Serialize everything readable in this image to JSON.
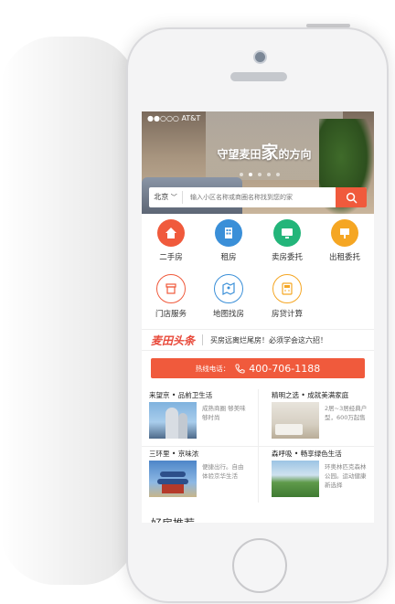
{
  "status_bar": {
    "carrier": "●●○○○ AT&T"
  },
  "hero": {
    "slogan_prefix": "守望麦田",
    "slogan_big": "家",
    "slogan_suffix": "的方向"
  },
  "search": {
    "city": "北京",
    "placeholder": "输入小区名称或商圈名称找到您的家"
  },
  "grid": {
    "items": [
      {
        "label": "二手房",
        "color": "#f05a3c",
        "icon": "house-icon"
      },
      {
        "label": "租房",
        "color": "#3a8fd8",
        "icon": "building-icon"
      },
      {
        "label": "卖房委托",
        "color": "#23b57a",
        "icon": "monitor-icon"
      },
      {
        "label": "出租委托",
        "color": "#f5a623",
        "icon": "sign-icon"
      },
      {
        "label": "门店服务",
        "color": "#f05a3c",
        "icon": "store-icon"
      },
      {
        "label": "地图找房",
        "color": "#3a8fd8",
        "icon": "map-icon"
      },
      {
        "label": "房贷计算",
        "color": "#f5a623",
        "icon": "calculator-icon"
      }
    ]
  },
  "news": {
    "brand": "麦田头条",
    "headline": "买房远离烂尾房！必须学会这六招！"
  },
  "hotline": {
    "label": "热线电话：",
    "number": "400-706-1188"
  },
  "cards": [
    {
      "title": "来望京 • 品前卫生活",
      "desc": "成熟商圈 够美味 够时尚",
      "img": "building-photo"
    },
    {
      "title": "精明之选 • 成就美满家庭",
      "desc": "2居~3居经典户型，600万起售",
      "img": "interior-photo"
    },
    {
      "title": "三环里 • 京味浓",
      "desc": "便捷出行。自由体验京华生活",
      "img": "temple-photo"
    },
    {
      "title": "森呼吸 • 畅享绿色生活",
      "desc": "环奥林匹克森林公园。运动健康新选择",
      "img": "park-photo"
    }
  ],
  "recommend": {
    "title": "好房推荐"
  }
}
